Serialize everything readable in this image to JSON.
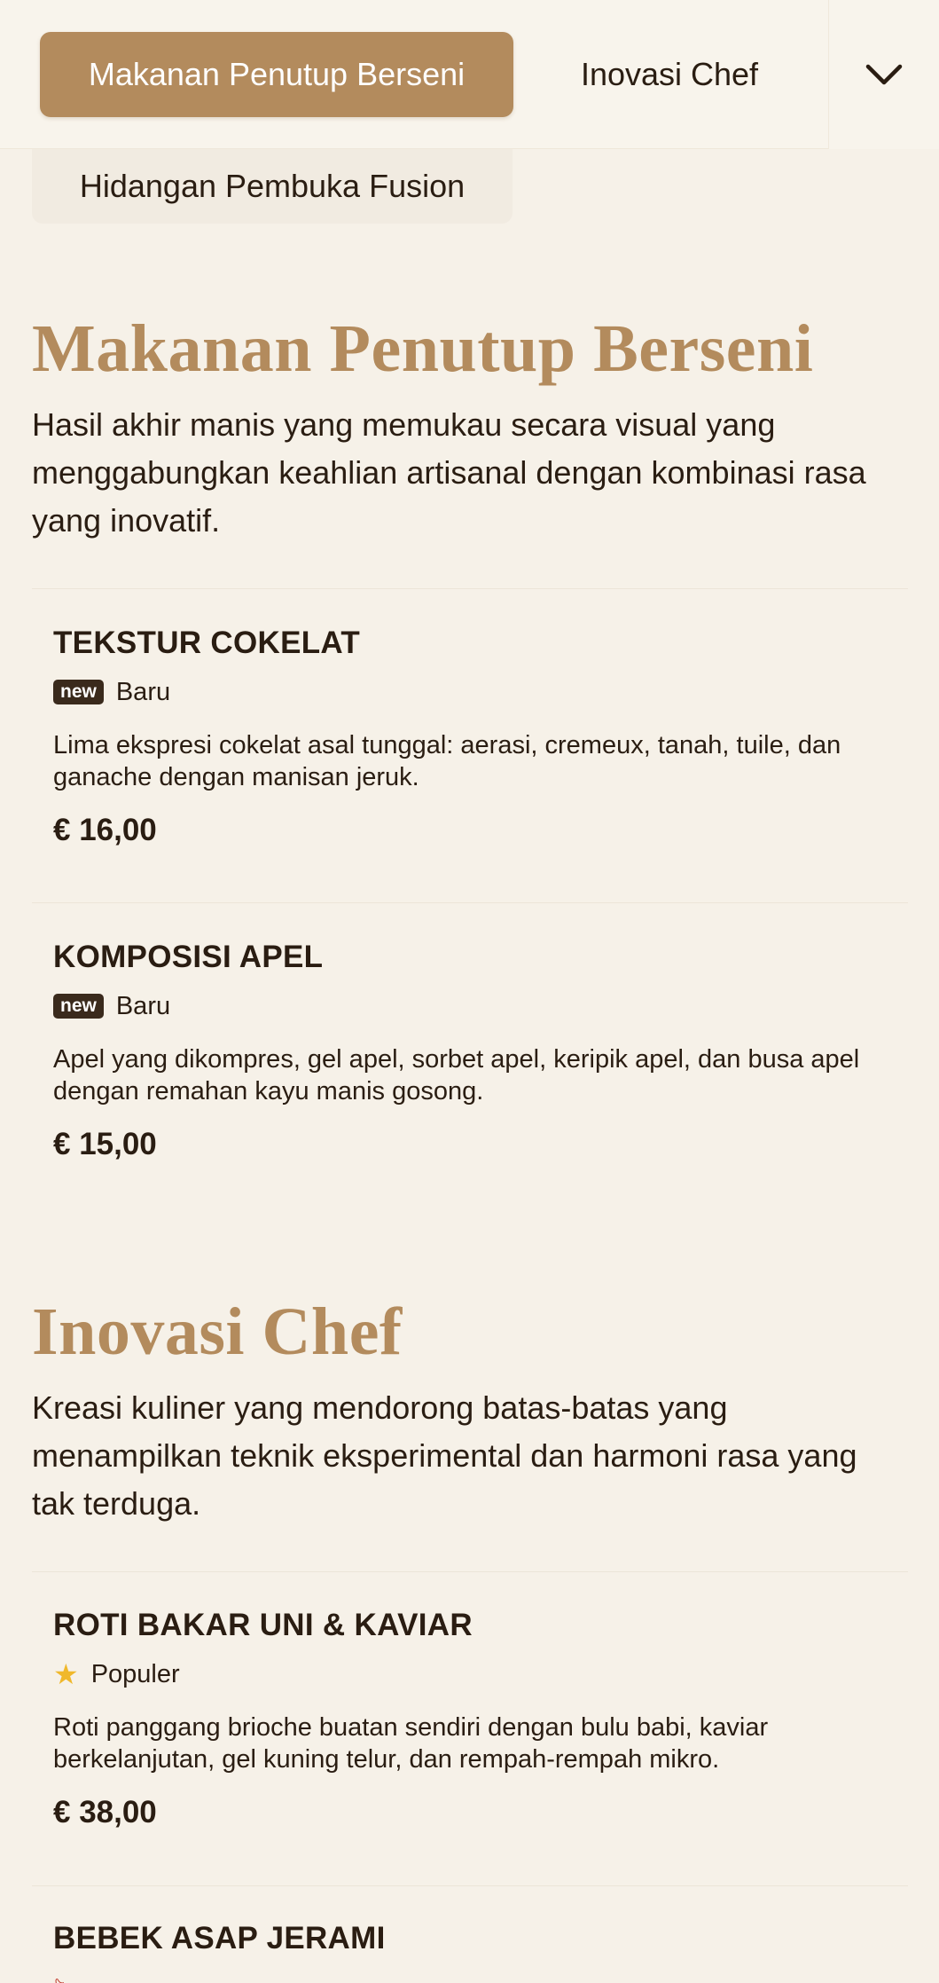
{
  "category_tabs": {
    "active": "Makanan Penutup Berseni",
    "next": "Inovasi Chef",
    "second_row": "Hidangan Pembuka Fusion"
  },
  "sections": [
    {
      "title": "Makanan Penutup Berseni",
      "description": "Hasil akhir manis yang memukau secara visual yang menggabungkan keahlian artisanal dengan kombinasi rasa yang inovatif.",
      "items": [
        {
          "name": "TEKSTUR COKELAT",
          "badge_pill": "new",
          "badge_label": "Baru",
          "description": "Lima ekspresi cokelat asal tunggal: aerasi, cremeux, tanah, tuile, dan ganache dengan manisan jeruk.",
          "price": "€ 16,00"
        },
        {
          "name": "KOMPOSISI APEL",
          "badge_pill": "new",
          "badge_label": "Baru",
          "description": "Apel yang dikompres, gel apel, sorbet apel, keripik apel, dan busa apel dengan remahan kayu manis gosong.",
          "price": "€ 15,00"
        }
      ]
    },
    {
      "title": "Inovasi Chef",
      "description": "Kreasi kuliner yang mendorong batas-batas yang menampilkan teknik eksperimental dan harmoni rasa yang tak terduga.",
      "items": [
        {
          "name": "ROTI BAKAR UNI & KAVIAR",
          "badge_icon": "star-icon",
          "badge_label": "Populer",
          "description": "Roti panggang brioche buatan sendiri dengan bulu babi, kaviar berkelanjutan, gel kuning telur, dan rempah-rempah mikro.",
          "price": "€ 38,00"
        },
        {
          "name": "BEBEK ASAP JERAMI"
        }
      ]
    }
  ],
  "colors": {
    "accent": "#b38b5d",
    "background": "#f6f1e8",
    "text": "#2a1d12",
    "star": "#f0b82b"
  }
}
